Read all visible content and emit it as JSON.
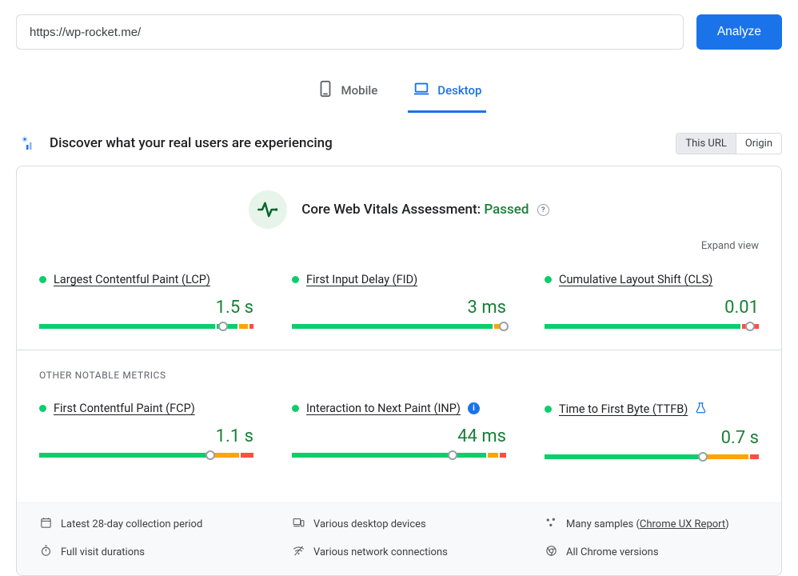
{
  "url_value": "https://wp-rocket.me/",
  "analyze_label": "Analyze",
  "tabs": {
    "mobile": "Mobile",
    "desktop": "Desktop"
  },
  "section_title": "Discover what your real users are experiencing",
  "toggle": {
    "this_url": "This URL",
    "origin": "Origin"
  },
  "assessment": {
    "prefix": "Core Web Vitals Assessment: ",
    "result": "Passed"
  },
  "expand_label": "Expand view",
  "metrics": {
    "lcp": {
      "label": "Largest Contentful Paint (LCP)",
      "value": "1.5 s",
      "segments": [
        84,
        10,
        4,
        2
      ],
      "marker": 86
    },
    "fid": {
      "label": "First Input Delay (FID)",
      "value": "3 ms",
      "segments": [
        95,
        0,
        4,
        1
      ],
      "marker": 99
    },
    "cls": {
      "label": "Cumulative Layout Shift (CLS)",
      "value": "0.01",
      "segments": [
        92,
        0,
        0,
        8
      ],
      "marker": 96
    },
    "fcp": {
      "label": "First Contentful Paint (FCP)",
      "value": "1.1 s",
      "segments": [
        80,
        0,
        14,
        6
      ],
      "marker": 80
    },
    "inp": {
      "label": "Interaction to Next Paint (INP)",
      "value": "44 ms",
      "segments": [
        92,
        0,
        5,
        3
      ],
      "marker": 75
    },
    "ttfb": {
      "label": "Time to First Byte (TTFB)",
      "value": "0.7 s",
      "segments": [
        74,
        0,
        22,
        4
      ],
      "marker": 74
    }
  },
  "other_metrics_label": "OTHER NOTABLE METRICS",
  "footer": {
    "period": "Latest 28-day collection period",
    "devices": "Various desktop devices",
    "samples_prefix": "Many samples (",
    "samples_link": "Chrome UX Report",
    "samples_suffix": ")",
    "durations": "Full visit durations",
    "connections": "Various network connections",
    "versions": "All Chrome versions"
  }
}
